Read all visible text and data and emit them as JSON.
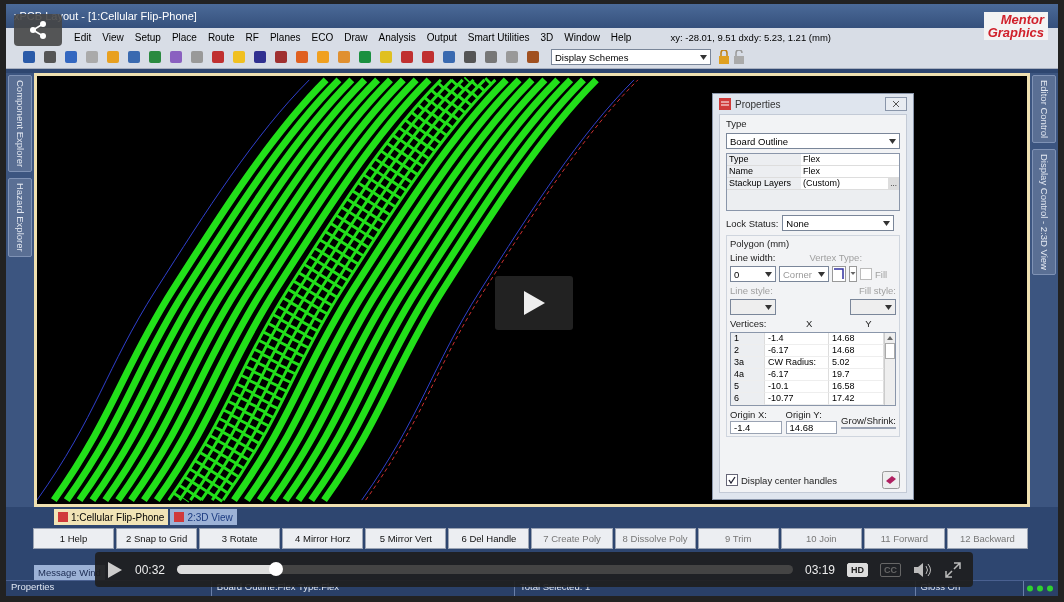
{
  "window": {
    "title": "xPCB Layout  - [1:Cellular Flip-Phone]",
    "logo": [
      "Mentor",
      "Graphics"
    ]
  },
  "menu": [
    "Edit",
    "View",
    "Setup",
    "Place",
    "Route",
    "RF",
    "Planes",
    "ECO",
    "Draw",
    "Analysis",
    "Output",
    "Smart Utilities",
    "3D",
    "Window",
    "Help"
  ],
  "coordinates": "xy: -28.01, 9.51  dxdy: 5.23, 1.21  (mm)",
  "display_schemes": "Display Schemes",
  "side_tabs_left": [
    {
      "label": "Component Explorer"
    },
    {
      "label": "Hazard Explorer"
    }
  ],
  "side_tabs_right": [
    {
      "label": "Editor Control"
    },
    {
      "label": "Display Control - 2:3D View"
    }
  ],
  "properties": {
    "title": "Properties",
    "type_label": "Type",
    "type_value": "Board Outline",
    "fields": [
      {
        "name": "Type",
        "value": "Flex"
      },
      {
        "name": "Name",
        "value": "Flex"
      },
      {
        "name": "Stackup Layers",
        "value": "(Custom)",
        "button": "..."
      }
    ],
    "lock_label": "Lock Status:",
    "lock_value": "None",
    "polygon_title": "Polygon (mm)",
    "line_width": {
      "label": "Line width:",
      "value": "0",
      "disabled": false
    },
    "vertex_type": {
      "label": "Vertex Type:",
      "value": "Corner",
      "disabled": true
    },
    "fill": {
      "label": "Fill",
      "checked": false
    },
    "line_style": {
      "label": "Line style:",
      "disabled": true
    },
    "fill_style": {
      "label": "Fill style:",
      "disabled": true
    },
    "vertices_label": "Vertices:",
    "columns": [
      "X",
      "Y"
    ],
    "vertices": [
      [
        "1",
        "-1.4",
        "14.68"
      ],
      [
        "2",
        "-6.17",
        "14.68"
      ],
      [
        "3a",
        "CW Radius:",
        "5.02"
      ],
      [
        "4a",
        "-6.17",
        "19.7"
      ],
      [
        "5",
        "-10.1",
        "16.58"
      ],
      [
        "6",
        "-10.77",
        "17.42"
      ]
    ],
    "origin_x": {
      "label": "Origin X:",
      "value": "-1.4"
    },
    "origin_y": {
      "label": "Origin Y:",
      "value": "14.68"
    },
    "grow": {
      "label": "Grow/Shrink:"
    },
    "center_handles": {
      "label": "Display center handles",
      "checked": true
    }
  },
  "document_tabs": [
    {
      "label": "1:Cellular Flip-Phone",
      "selected": true
    },
    {
      "label": "2:3D View",
      "selected": false
    }
  ],
  "function_keys": [
    {
      "label": "1 Help",
      "disabled": false
    },
    {
      "label": "2 Snap to Grid",
      "disabled": false
    },
    {
      "label": "3 Rotate",
      "disabled": false
    },
    {
      "label": "4 Mirror Horz",
      "disabled": false
    },
    {
      "label": "5 Mirror Vert",
      "disabled": false
    },
    {
      "label": "6 Del Handle",
      "disabled": false
    },
    {
      "label": "7 Create Poly",
      "disabled": true
    },
    {
      "label": "8 Dissolve Poly",
      "disabled": true
    },
    {
      "label": "9 Trim",
      "disabled": true
    },
    {
      "label": "10 Join",
      "disabled": true
    },
    {
      "label": "11 Forward",
      "disabled": true
    },
    {
      "label": "12 Backward",
      "disabled": true
    }
  ],
  "message_tab": "Message Wind",
  "status_bar": [
    "Properties",
    "Board Outline:Flex Type:Flex",
    "Total Selected: 1",
    "Gloss On"
  ],
  "video": {
    "current": "00:32",
    "duration": "03:19",
    "level": 0.16,
    "hd": "HD",
    "cc": "CC"
  }
}
